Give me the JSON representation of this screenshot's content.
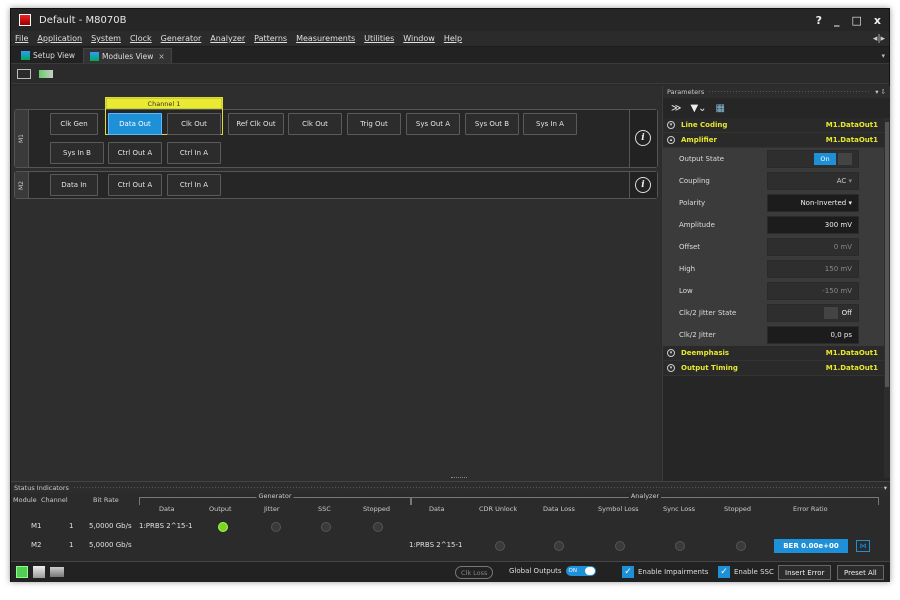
{
  "window": {
    "title": "Default - M8070B",
    "help": "?",
    "minimize": "_",
    "maximize": "□",
    "close": "x"
  },
  "menu": [
    {
      "label": "File"
    },
    {
      "label": "Application"
    },
    {
      "label": "System"
    },
    {
      "label": "Clock"
    },
    {
      "label": "Generator"
    },
    {
      "label": "Analyzer"
    },
    {
      "label": "Patterns"
    },
    {
      "label": "Measurements"
    },
    {
      "label": "Utilities"
    },
    {
      "label": "Window"
    },
    {
      "label": "Help"
    }
  ],
  "tabs": [
    {
      "label": "Setup View"
    },
    {
      "label": "Modules View",
      "close": "×"
    }
  ],
  "modules": {
    "m1": {
      "label": "M1",
      "channel_label": "Channel 1",
      "row1": [
        "Clk Gen",
        "Data Out",
        "Clk Out",
        "Ref Clk Out",
        "Clk Out",
        "Trig Out",
        "Sys Out A",
        "Sys Out B",
        "Sys In A"
      ],
      "row2": [
        "Sys In B",
        "Ctrl Out A",
        "Ctrl In A"
      ]
    },
    "m2": {
      "label": "M2",
      "row1": [
        "Data In",
        "Ctrl Out A",
        "Ctrl In A"
      ]
    },
    "info_glyph": "i"
  },
  "parameters": {
    "title": "Parameters",
    "pin": "▾ ⇩",
    "sections": {
      "line_coding": {
        "label": "Line Coding",
        "value": "M1.DataOut1"
      },
      "amplifier": {
        "label": "Amplifier",
        "value": "M1.DataOut1"
      },
      "deemphasis": {
        "label": "Deemphasis",
        "value": "M1.DataOut1"
      },
      "output_timing": {
        "label": "Output Timing",
        "value": "M1.DataOut1"
      }
    },
    "rows": {
      "output_state": {
        "label": "Output State",
        "value": "On"
      },
      "coupling": {
        "label": "Coupling",
        "value": "AC"
      },
      "polarity": {
        "label": "Polarity",
        "value": "Non-Inverted"
      },
      "amplitude": {
        "label": "Amplitude",
        "value": "300 mV"
      },
      "offset": {
        "label": "Offset",
        "value": "0 mV"
      },
      "high": {
        "label": "High",
        "value": "150 mV"
      },
      "low": {
        "label": "Low",
        "value": "-150 mV"
      },
      "clk2_state": {
        "label": "Clk/2 Jitter State",
        "value": "Off"
      },
      "clk2_jitter": {
        "label": "Clk/2 Jitter",
        "value": "0,0 ps"
      }
    }
  },
  "status": {
    "title": "Status Indicators",
    "groups": {
      "generator": "Generator",
      "analyzer": "Analyzer"
    },
    "columns": {
      "module": "Module",
      "channel": "Channel",
      "bit_rate": "Bit Rate",
      "g_data": "Data",
      "g_output": "Output",
      "g_jitter": "Jitter",
      "g_ssc": "SSC",
      "g_stopped": "Stopped",
      "a_data": "Data",
      "a_cdr": "CDR Unlock",
      "a_dataloss": "Data Loss",
      "a_symloss": "Symbol Loss",
      "a_syncloss": "Sync Loss",
      "a_stopped": "Stopped",
      "error_ratio": "Error Ratio"
    },
    "rows": [
      {
        "module": "M1",
        "channel": "1",
        "bit_rate": "5,0000 Gb/s",
        "gen_data": "1:PRBS 2^15-1",
        "ana_data": ""
      },
      {
        "module": "M2",
        "channel": "1",
        "bit_rate": "5,0000 Gb/s",
        "gen_data": "",
        "ana_data": "1:PRBS 2^15-1",
        "ber": "BER 0.00e+00"
      }
    ]
  },
  "bottom": {
    "clk_loss": "Clk Loss",
    "global_outputs": "Global Outputs",
    "global_toggle": "ON",
    "enable_impairments": "Enable Impairments",
    "enable_ssc": "Enable SSC",
    "insert_error": "Insert Error",
    "preset_all": "Preset All"
  },
  "colors": {
    "accent": "#1e90d8",
    "channel": "#eaea32",
    "led_on": "#7ed321"
  }
}
